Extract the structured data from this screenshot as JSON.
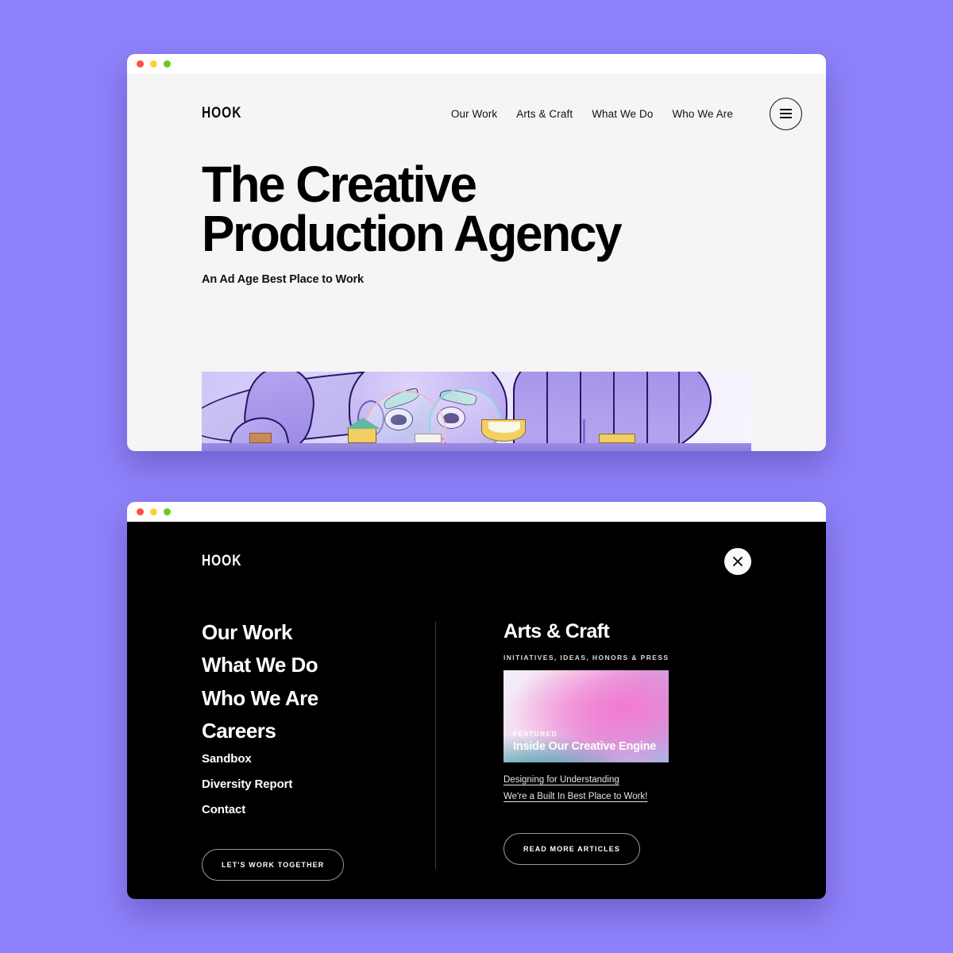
{
  "background_color": "#8e82fa",
  "window_a": {
    "name": "hero-window",
    "traffic_lights": [
      "close",
      "minimize",
      "zoom"
    ],
    "brand": "HOOK",
    "nav": [
      {
        "label": "Our Work"
      },
      {
        "label": "Arts & Craft"
      },
      {
        "label": "What We Do"
      },
      {
        "label": "Who We Are"
      }
    ],
    "menu_icon": "hamburger-icon",
    "hero": {
      "title_line1": "The Creative",
      "title_line2": "Production Agency",
      "subtitle": "An Ad Age Best Place to Work"
    },
    "illustration_alt": "purple cartoon bird character with round glasses behind a desk"
  },
  "window_b": {
    "name": "menu-overlay-window",
    "brand": "HOOK",
    "close_icon": "close-x-icon",
    "menu_primary": [
      {
        "label": "Our Work"
      },
      {
        "label": "What We Do"
      },
      {
        "label": "Who We Are"
      },
      {
        "label": "Careers"
      }
    ],
    "menu_secondary": [
      {
        "label": "Sandbox"
      },
      {
        "label": "Diversity Report"
      },
      {
        "label": "Contact"
      }
    ],
    "cta_left": "LET'S WORK TOGETHER",
    "panel_right": {
      "title": "Arts & Craft",
      "eyebrow": "INITIATIVES, IDEAS, HONORS & PRESS",
      "feature_card": {
        "eyebrow": "FEATURED",
        "title": "Inside Our Creative Engine",
        "gradient_colors": [
          "#35a3a8",
          "#f27ad0",
          "#a9b6e6",
          "#f3f0fb"
        ]
      },
      "links": [
        {
          "label": "Designing for Understanding"
        },
        {
          "label": "We're a Built In Best Place to Work!"
        }
      ],
      "cta": "READ MORE ARTICLES"
    }
  }
}
